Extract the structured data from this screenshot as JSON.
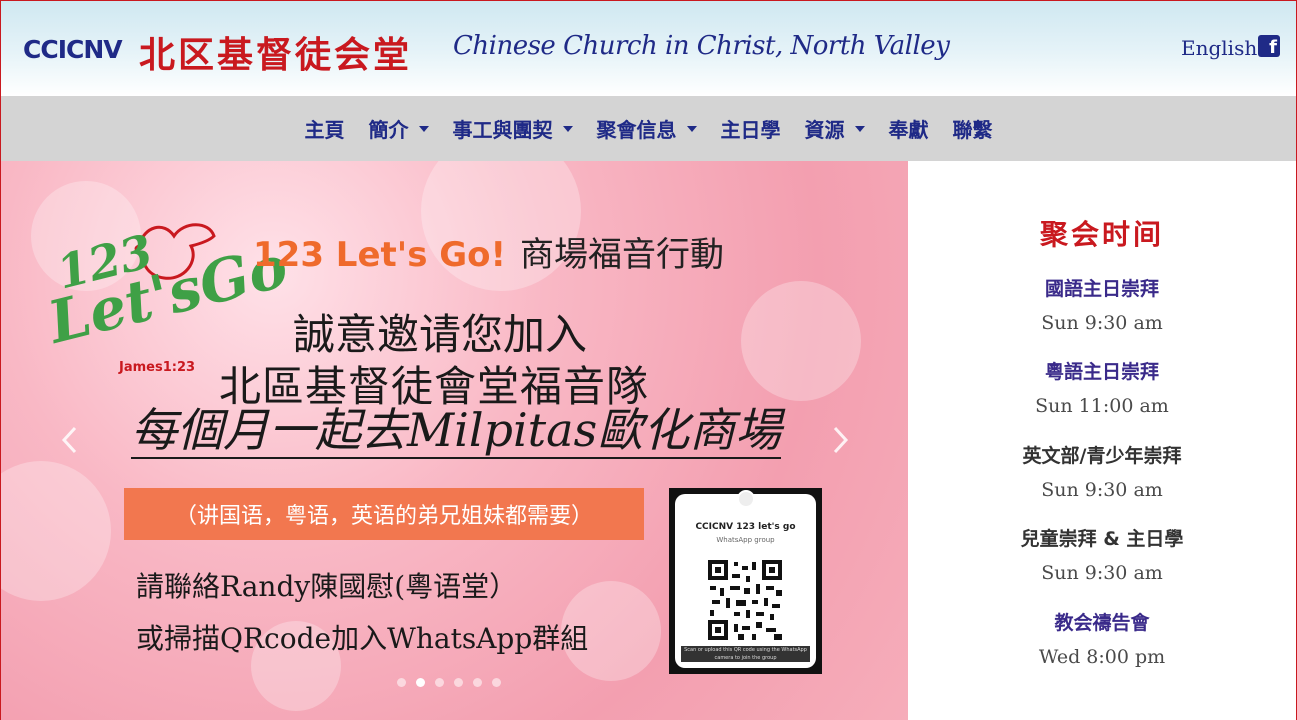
{
  "header": {
    "logo_text": "CCICNV",
    "title_cn": "北区基督徒会堂",
    "title_en": "Chinese Church in Christ, North Valley",
    "language_link": "English",
    "social_icon": "facebook-icon"
  },
  "nav": {
    "items": [
      {
        "label": "主頁",
        "dropdown": false
      },
      {
        "label": "簡介",
        "dropdown": true
      },
      {
        "label": "事工與團契",
        "dropdown": true
      },
      {
        "label": "聚會信息",
        "dropdown": true
      },
      {
        "label": "主日學",
        "dropdown": false
      },
      {
        "label": "資源",
        "dropdown": true
      },
      {
        "label": "奉獻",
        "dropdown": false
      },
      {
        "label": "聯繫",
        "dropdown": false
      }
    ]
  },
  "slide": {
    "logo_number": "123",
    "logo_word": "Let'sGo",
    "logo_verse": "James1:23",
    "title_en": "123 Let's Go!",
    "title_cn": "商場福音行動",
    "line1": "誠意邀请您加入",
    "line2": "北區基督徒會堂福音隊",
    "line3": "每個月一起去Milpitas歐化商場",
    "banner": "（讲国语，粤语，英语的弟兄姐妹都需要）",
    "contact1": "請聯絡Randy陳國慰(粵语堂）",
    "contact2": "或掃描QRcode加入WhatsApp群組",
    "qr_title": "CCICNV 123 let's go",
    "qr_subtitle": "WhatsApp group",
    "qr_footer": "Scan or upload this QR code using the WhatsApp camera to join the group",
    "slide_count": 6,
    "active_index": 1
  },
  "side": {
    "heading": "聚会时间",
    "services": [
      {
        "name": "國語主日崇拜",
        "time": "Sun 9:30 am",
        "color": "#3a2a8a"
      },
      {
        "name": "粵語主日崇拜",
        "time": "Sun 11:00 am",
        "color": "#3a2a8a"
      },
      {
        "name": "英文部/青少年崇拜",
        "time": "Sun 9:30 am",
        "color": "#333333"
      },
      {
        "name": "兒童崇拜 & 主日學",
        "time": "Sun 9:30 am",
        "color": "#333333"
      },
      {
        "name": "教会禱告會",
        "time": "Wed 8:00 pm",
        "color": "#3a2a8a"
      }
    ]
  },
  "colors": {
    "brand_red": "#c9191f",
    "brand_navy": "#1f2a87",
    "nav_bg": "#d4d4d4",
    "banner_orange": "#f2774f"
  }
}
